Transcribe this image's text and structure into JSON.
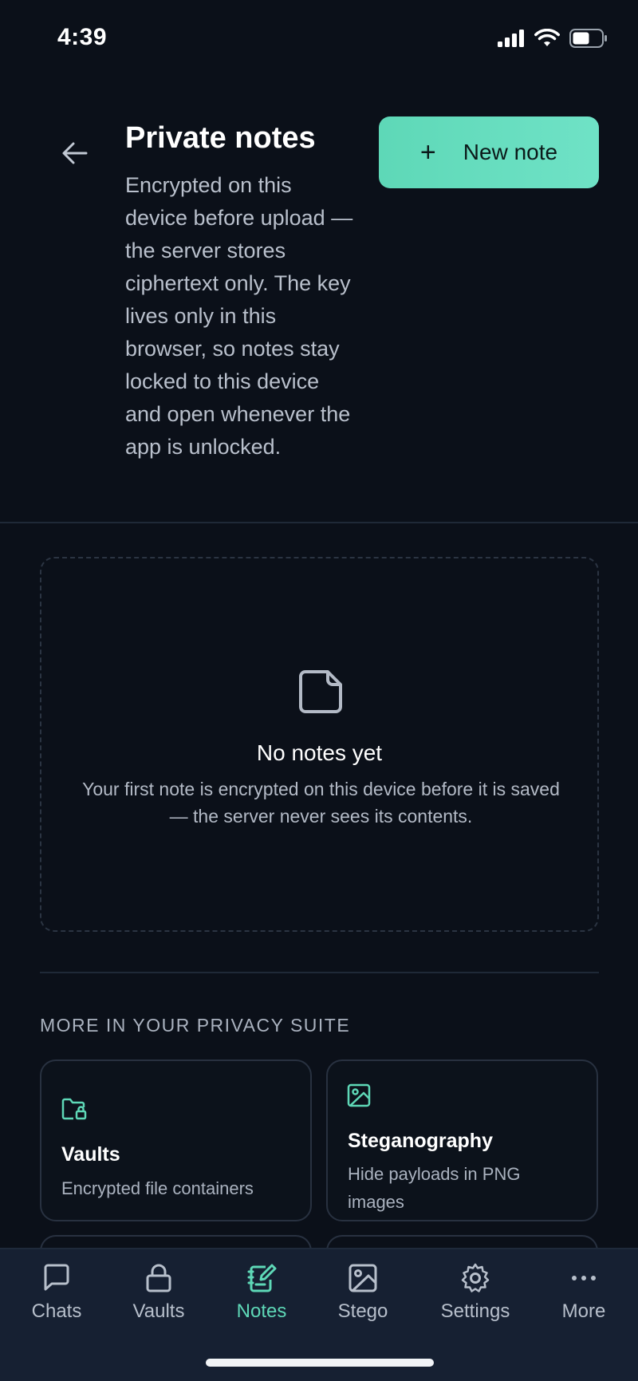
{
  "status_bar": {
    "time": "4:39"
  },
  "header": {
    "title": "Private notes",
    "description": "Encrypted on this device before upload — the server stores ciphertext only. The key lives only in this browser, so notes stay locked to this device and open whenever the app is unlocked.",
    "new_note_label": "New note",
    "new_note_icon": "+"
  },
  "empty_state": {
    "title": "No notes yet",
    "description": "Your first note is encrypted on this device before it is saved — the server never sees its contents."
  },
  "suite": {
    "heading": "MORE IN YOUR PRIVACY SUITE",
    "cards": [
      {
        "title": "Vaults",
        "description": "Encrypted file containers",
        "icon": "folder-lock-icon"
      },
      {
        "title": "Steganography",
        "description": "Hide payloads in PNG images",
        "icon": "image-icon"
      }
    ]
  },
  "nav": {
    "items": [
      {
        "label": "Chats",
        "icon": "chat-icon"
      },
      {
        "label": "Vaults",
        "icon": "lock-icon"
      },
      {
        "label": "Notes",
        "icon": "notebook-icon",
        "active": true
      },
      {
        "label": "Stego",
        "icon": "image-icon"
      },
      {
        "label": "Settings",
        "icon": "gear-icon"
      },
      {
        "label": "More",
        "icon": "more-icon"
      }
    ]
  },
  "colors": {
    "background": "#0b1019",
    "accent": "#5ed8b7",
    "nav_background": "#162032"
  }
}
